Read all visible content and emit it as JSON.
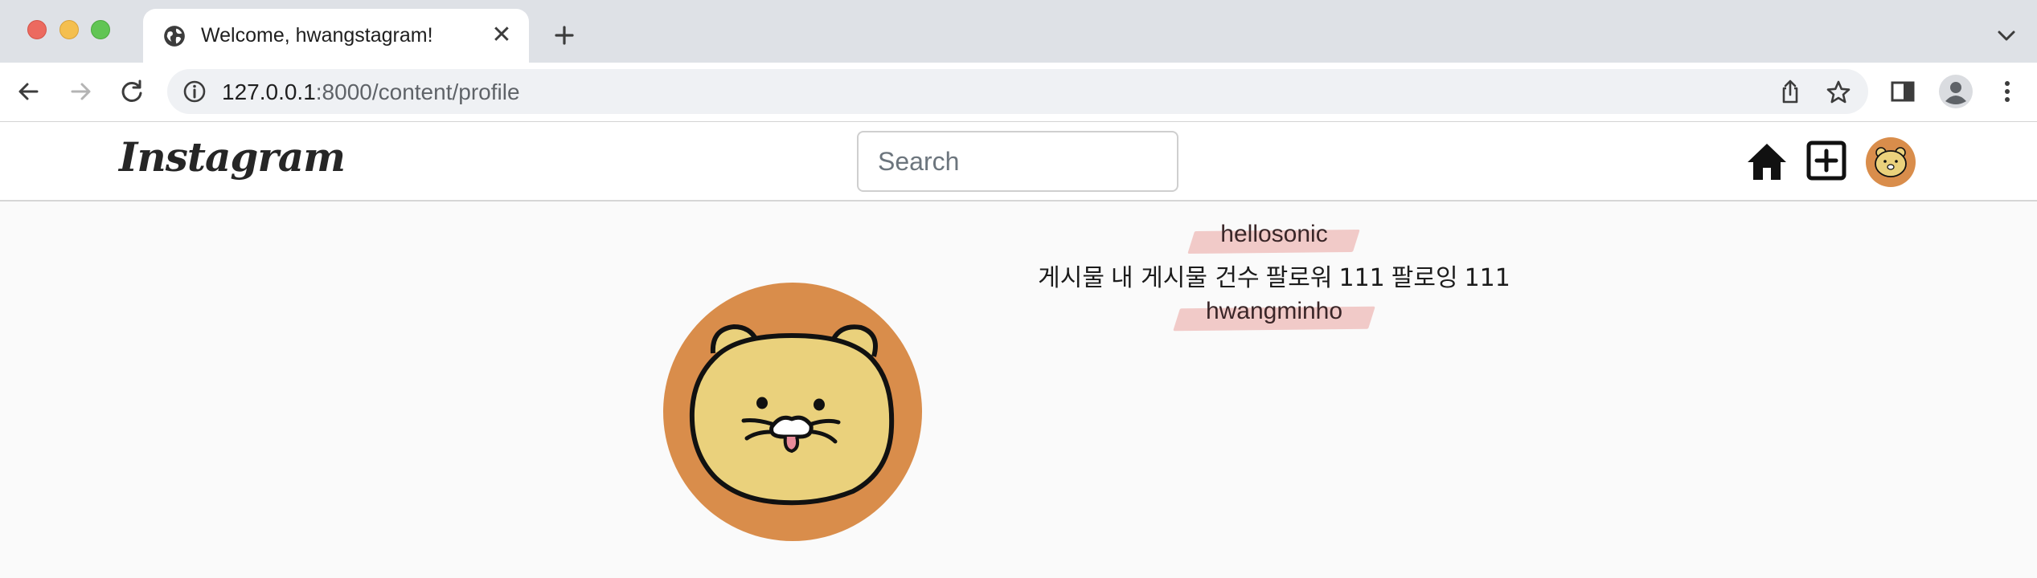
{
  "browser": {
    "tab": {
      "title": "Welcome, hwangstagram!",
      "close": "✕"
    },
    "address": {
      "host": "127.0.0.1",
      "rest": ":8000/content/profile"
    }
  },
  "navbar": {
    "logo": "Instagram",
    "search_placeholder": "Search"
  },
  "profile": {
    "top_name": "hellosonic",
    "stats": {
      "posts_label": "게시물",
      "posts_value": "내 게시물 건수",
      "followers_label": "팔로워",
      "followers_value": "111",
      "following_label": "팔로잉",
      "following_value": "111"
    },
    "bottom_name": "hwangminho"
  },
  "colors": {
    "avatar_bg": "#d98d4b",
    "avatar_face": "#ead17c",
    "highlight": "#efc4c2"
  },
  "icons": {
    "tab_favicon": "globe-icon",
    "home": "home-icon",
    "add_post": "plus-square-icon",
    "avatar": "bear-avatar-icon"
  }
}
